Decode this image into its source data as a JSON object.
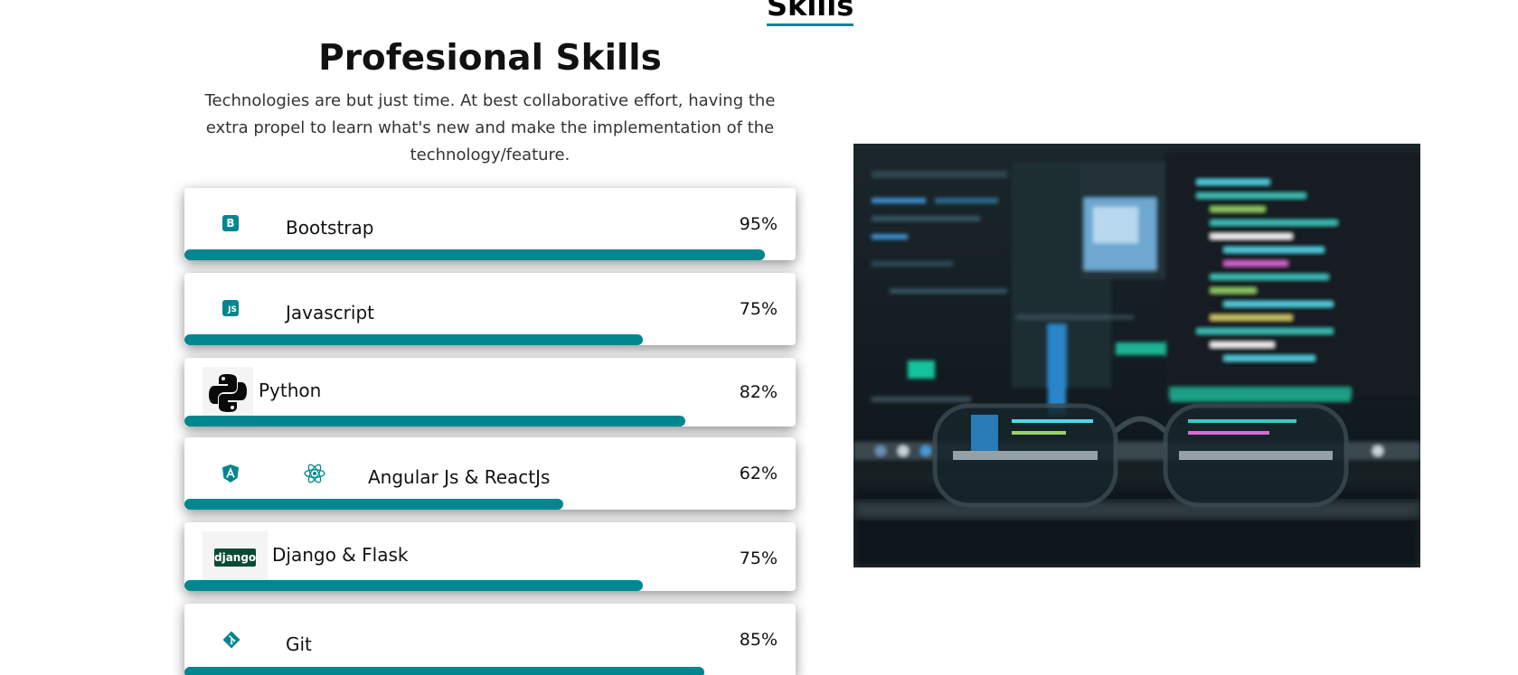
{
  "section": {
    "title": "Skills"
  },
  "professional": {
    "title": "Profesional Skills",
    "intro": "Technologies are but just time. At best collaborative effort, having the extra propel to learn what's new and make the implementation of the technology/feature."
  },
  "skills": [
    {
      "name": "Bootstrap",
      "percent_label": "95%",
      "level": 0.95,
      "icon": "bootstrap-icon"
    },
    {
      "name": "Javascript",
      "percent_label": "75%",
      "level": 0.75,
      "icon": "javascript-icon"
    },
    {
      "name": "Python",
      "percent_label": "82%",
      "level": 0.82,
      "icon": "python-logo-icon"
    },
    {
      "name": "Angular Js & ReactJs",
      "percent_label": "62%",
      "level": 0.62,
      "icon": "angular-icon"
    },
    {
      "name": "Django & Flask",
      "percent_label": "75%",
      "level": 0.75,
      "icon": "django-logo-icon",
      "logo_text": "django"
    },
    {
      "name": "Git",
      "percent_label": "85%",
      "level": 0.85,
      "icon": "git-icon"
    }
  ],
  "colors": {
    "accent": "#00868f",
    "django": "#0c4b33"
  },
  "js_icon_text": "JS",
  "bootstrap_icon_text": "B"
}
